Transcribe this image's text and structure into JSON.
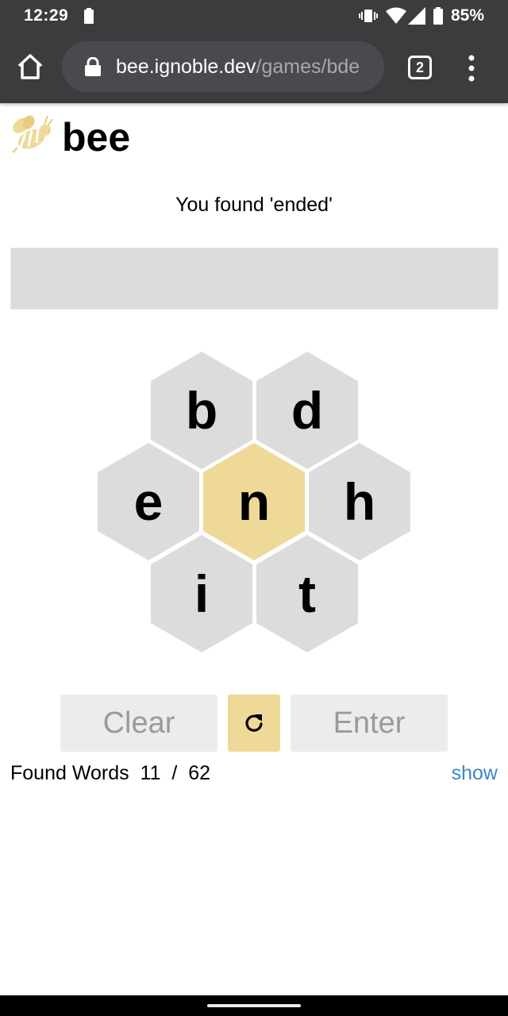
{
  "status_bar": {
    "time": "12:29",
    "battery_percent": "85%",
    "icons": [
      "battery-saver-icon",
      "vibrate-icon",
      "wifi-icon",
      "cell-signal-icon",
      "battery-icon"
    ]
  },
  "browser": {
    "url_host": "bee.ignoble.dev",
    "url_path": "/games/bde",
    "tab_count": "2",
    "icons": [
      "home-icon",
      "lock-icon",
      "menu-dots-icon"
    ]
  },
  "app": {
    "title": "bee",
    "logo_icon": "bee-icon",
    "message": "You found 'ended'",
    "current_word": ""
  },
  "hive": {
    "center_letter": "n",
    "letters": [
      "b",
      "d",
      "e",
      "n",
      "h",
      "i",
      "t"
    ],
    "center_color": "#eed998",
    "outer_color": "#dcdcdc"
  },
  "controls": {
    "clear_label": "Clear",
    "enter_label": "Enter",
    "shuffle_icon": "shuffle-icon"
  },
  "found_words": {
    "label": "Found Words",
    "found": "11",
    "separator": "/",
    "total": "62",
    "show_label": "show"
  },
  "colors": {
    "accent": "#eed998",
    "link": "#3a87c8",
    "chrome": "#3c3c3f"
  }
}
